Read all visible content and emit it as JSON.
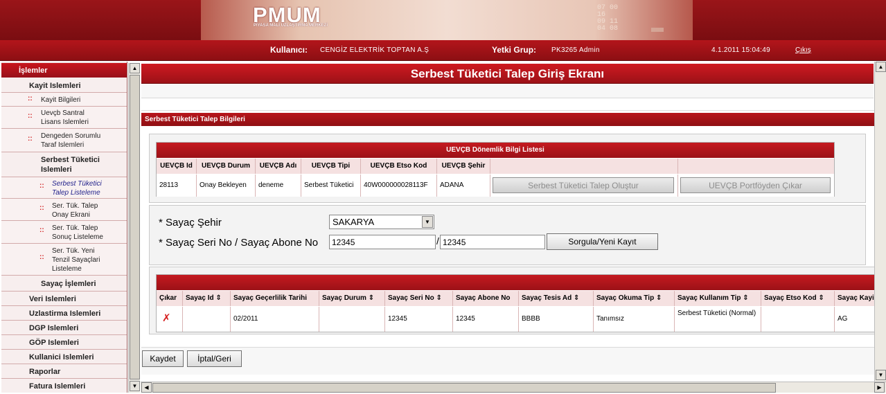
{
  "banner": {
    "logo": "PMUM",
    "logo_sub": "PİYASA MALİ UZLAŞTIRMA MERKEZİ",
    "digits": [
      "07 00",
      "16",
      "09 11",
      "04 08"
    ]
  },
  "userbar": {
    "user_label": "Kullanıcı:",
    "user_value": "CENGİZ ELEKTRİK TOPTAN A.Ş",
    "group_label": "Yetki Grup:",
    "group_value": "PK3265 Admin",
    "datetime": "4.1.2011 15:04:49",
    "logout": "Çıkış"
  },
  "sidebar": {
    "header": "İşlemler",
    "kayit": "Kayit Islemleri",
    "kayit_bilgileri": "Kayit Bilgileri",
    "sentral_1": "Uevçb Santral",
    "sentral_2": "Lisans Islemleri",
    "dengeden_1": "Dengeden Sorumlu",
    "dengeden_2": "Taraf Islemleri",
    "serbest_1": "Serbest Tüketici",
    "serbest_2": "Islemleri",
    "talep_list_1": "Serbest Tüketici",
    "talep_list_2": "Talep Listeleme",
    "onay_1": "Ser. Tük. Talep",
    "onay_2": "Onay Ekrani",
    "sonuc_1": "Ser. Tük. Talep",
    "sonuc_2": "Sonuç Listeleme",
    "tenzil_1": "Ser. Tük. Yeni",
    "tenzil_2": "Tenzil Sayaçlari",
    "tenzil_3": "Listeleme",
    "sayac": "Sayaç İşlemleri",
    "veri": "Veri Islemleri",
    "uzlastirma": "Uzlastirma Islemleri",
    "dgp": "DGP Islemleri",
    "gop": "GÖP Islemleri",
    "kullanici": "Kullanici Islemleri",
    "raporlar": "Raporlar",
    "fatura": "Fatura Islemleri"
  },
  "page": {
    "title": "Serbest Tüketici Talep Giriş Ekranı",
    "section": "Serbest Tüketici Talep Bilgileri"
  },
  "donemlik": {
    "caption": "UEVÇB Dönemlik Bilgi Listesi",
    "headers": [
      "UEVÇB Id",
      "UEVÇB Durum",
      "UEVÇB Adı",
      "UEVÇB Tipi",
      "UEVÇB Etso Kod",
      "UEVÇB Şehir"
    ],
    "row": [
      "28113",
      "Onay Bekleyen",
      "deneme",
      "Serbest Tüketici",
      "40W000000028113F",
      "ADANA"
    ],
    "create_btn": "Serbest Tüketici Talep Oluştur",
    "remove_btn": "UEVÇB Portföyden Çıkar"
  },
  "form": {
    "city_label": "* Sayaç Şehir",
    "city_value": "SAKARYA",
    "serial_label": "* Sayaç Seri No / Sayaç Abone No",
    "serial_value": "12345",
    "separator": "/",
    "abone_value": "12345",
    "query_btn": "Sorgula/Yeni Kayıt"
  },
  "sayac_table": {
    "headers": [
      "Çıkar",
      "Sayaç Id ⇕",
      "Sayaç Geçerlilik Tarihi",
      "Sayaç Durum ⇕",
      "Sayaç Seri No ⇕",
      "Sayaç Abone No",
      "Sayaç Tesis Ad ⇕",
      "Sayaç Okuma Tip ⇕",
      "Sayaç Kullanım Tip ⇕",
      "Sayaç Etso Kod ⇕",
      "Sayaç Kayip T"
    ],
    "row": [
      "",
      "",
      "02/2011",
      "",
      "12345",
      "12345",
      "BBBB",
      "Tanımsız",
      "Serbest Tüketici (Normal)",
      "",
      "AG"
    ]
  },
  "buttons": {
    "save": "Kaydet",
    "cancel": "İptal/Geri"
  }
}
